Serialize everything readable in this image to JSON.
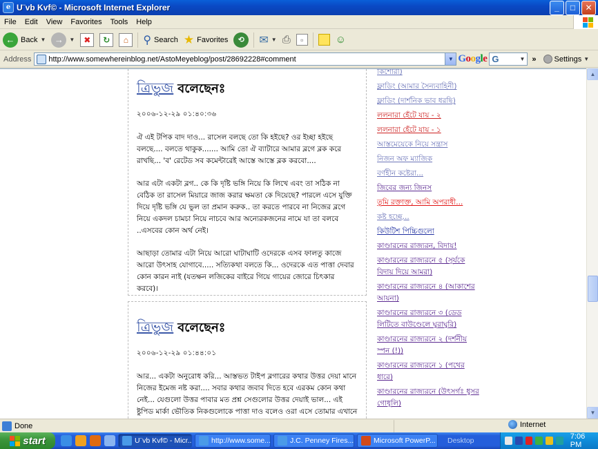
{
  "window": {
    "title": "U¨vb Kvf© - Microsoft Internet Explorer",
    "app_icon_glyph": "e",
    "buttons": {
      "minimize": "_",
      "maximize": "□",
      "close": "✕"
    }
  },
  "menu": [
    "File",
    "Edit",
    "View",
    "Favorites",
    "Tools",
    "Help"
  ],
  "toolbar": {
    "back": "Back",
    "search": "Search",
    "favorites": "Favorites"
  },
  "address": {
    "label": "Address",
    "url": "http://www.somewhereinblog.net/AstoMeyeblog/post/28692228#comment"
  },
  "google_bar": {
    "logo": "Google",
    "box_value": "G",
    "more": "»",
    "settings": "Settings"
  },
  "posts": [
    {
      "author": "ত্রিভুজ",
      "said": "বলেছেনঃ",
      "date": "২০০৬-১২-২৯ ০১:৪০:৩৬",
      "paragraphs": [
        "ঐ এই টপিক বাদ দাও... রাসেল বলছে তো কি হইছে? ওর ইচ্ছা হইছে বলছে.... বলতে থাকুক....... আমি তো ঐ ব্যাটারে আমার ব্লগে ব্লক করে রাখছি... 'ব' রেটেড সব কমেন্টারেই আস্তে আস্তে ব্লক করবো....",
        "আর এটা একটা ব্লগ.. কে কি দৃষ্টি ভঙ্গি নিয়ে কি লিখে এবং তা সঠিক না বেঠিক তা রাসেল মিয়ারে জাজ করার ক্ষমতা কে দিয়েছে? পারলে এসে যুক্তি দিয়ে দৃষ্টি ভঙ্গি যে ভুল তা প্রমান করুক.. তা করতে পারবে না নিজের ব্লগে নিয়ে একদল চামচা নিয়ে নাচবে আর অন্যেরকজনের নামে যা তা বলবে ..এসবের কোন অর্থ নেই।",
        "আছাড়া তোমার এটা নিয়ে আরো ঘাটাঘাটি ওদেরকে এসব ফালতু কাজে আরো উৎসাহ যোগাবে..... সত্যিকথা বলতে কি... ওদেরকে এত পাত্তা দেবার কোন কারন নাই (যতক্ষন লজিকের বাইরে গিয়ে গায়ের জোরে চিৎকার করবে)।"
      ]
    },
    {
      "author": "ত্রিভুজ",
      "said": "বলেছেনঃ",
      "date": "২০০৬-১২-২৯ ০১:৪৪:০১",
      "paragraphs": [
        "আর... একটা অনুরোধ করি... আস্তভত টাইপ ব্লগারের কথার উত্তর দেয়া মানে নিজের ইমেজ নষ্ট করা.... সবার কথার জবাব দিতে হবে এরকম কোন কথা নেই... যেগুলো উত্তর পাবার মত প্রশ্ন সেগুলোর উত্তর দেয়াই ভাল... এই ষ্টুপিড মার্কা ভৌতিক নিকগুলোকে পাত্তা দাও বলেও ওরা এসে তোমার এখানে যা খুশি বলে বেড়ায়.... হয় ইগনোর করো... অর ব্লক মারো...."
      ]
    }
  ],
  "sidebar": [
    {
      "text": "কিশোরী)",
      "color": "old"
    },
    {
      "text": "ফ্লাডিং (আমার সৈন্যবাহিনী)",
      "color": "old"
    },
    {
      "text": "ফ্লাডিং (দার্শনিক ভাব ধরছি)",
      "color": "old"
    },
    {
      "text": "ললনারা হেঁটে যায় - ২",
      "color": "red"
    },
    {
      "text": "ললনারা হেঁটে যায় - ১",
      "color": "red"
    },
    {
      "text": "আস্তমেয়েকে নিয়ে সন্ত্রাস",
      "color": "old"
    },
    {
      "text": "নিজন অফ ম্যাজিক",
      "color": "old"
    },
    {
      "text": "বর্ণহীন কষ্টেরা...",
      "color": "old"
    },
    {
      "text": "জিবের জন্য জিনস",
      "color": "purple"
    },
    {
      "text": "তুমি রক্তাক্ত, আমি অপরাধী...",
      "color": "bright"
    },
    {
      "text": "কষ্ট হচ্ছে...",
      "color": "old"
    },
    {
      "text": "কিউটিশ পিচ্চিগুলো",
      "color": "blue"
    },
    {
      "text": "কাণ্ডারনের রাজ্যরন, বিদায়!",
      "color": "purple"
    },
    {
      "text": "কাণ্ডারনের রাজ্যরনে ৫ (সূর্যকে বিদায় দিয়ে আমরা)",
      "color": "purple"
    },
    {
      "text": "কাণ্ডারনের রাজ্যরনে ৪ (আকাশের আয়না)",
      "color": "purple"
    },
    {
      "text": "কাণ্ডারনের রাজ্যরনে ৩ (ডেড লিটিতে বাউণ্ডেলে ঘুরাঘুরি)",
      "color": "purple"
    },
    {
      "text": "কাণ্ডারনের রাজ্যরনে ২ (দর্শনীয় স্পন (!))",
      "color": "purple"
    },
    {
      "text": "কাণ্ডারনের রাজ্যরনে ১ (পথের ধারে)",
      "color": "purple"
    },
    {
      "text": "কাণ্ডারনের রাজ্যরনে (উৎসর্গঃ ধুসর গোধূলি)",
      "color": "purple"
    }
  ],
  "status": {
    "text": "Done",
    "zone": "Internet"
  },
  "taskbar": {
    "start": "start",
    "tasks": [
      {
        "label": "U¨vb Kvf© - Micr...",
        "active": true
      },
      {
        "label": "http://www.some...",
        "active": false
      },
      {
        "label": "J.C. Penney Fires...",
        "active": false
      },
      {
        "label": "Microsoft PowerP...",
        "active": false
      }
    ],
    "desktop": "Desktop",
    "clock": "7:06 PM"
  }
}
